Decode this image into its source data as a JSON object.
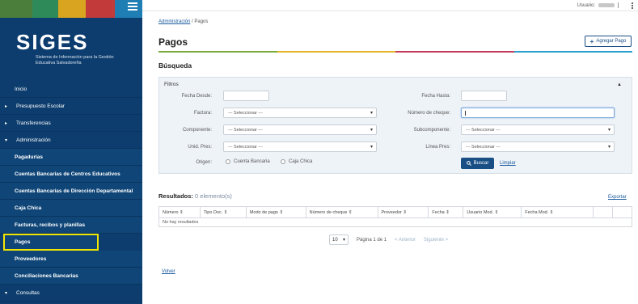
{
  "colors": {
    "sidebar": "#0d3d6e",
    "accent": "#1a4f86",
    "highlight": "#f2e600",
    "stripes": [
      "#4a7e3a",
      "#2f8a5a",
      "#d9a520",
      "#c33a3a",
      "#1f7fb5"
    ]
  },
  "sidebar": {
    "logo_title": "SIGES",
    "logo_subtitle": "Sistema de Información para la Gestión Educativa Salvadoreña",
    "menu_icon": "hamburger-icon",
    "items": [
      {
        "label": "Inicio"
      },
      {
        "label": "Presupuesto Escolar"
      },
      {
        "label": "Transferencias"
      },
      {
        "label": "Administración"
      },
      {
        "label": "Pagadurías"
      },
      {
        "label": "Cuentas Bancarias de Centros Educativos"
      },
      {
        "label": "Cuentas Bancarias de Dirección Departamental"
      },
      {
        "label": "Caja Chica"
      },
      {
        "label": "Facturas, recibos y planillas"
      },
      {
        "label": "Pagos"
      },
      {
        "label": "Proveedores"
      },
      {
        "label": "Conciliaciones Bancarias"
      },
      {
        "label": "Consultas"
      }
    ]
  },
  "topbar": {
    "user_label": "Usuario:",
    "sep": "|"
  },
  "breadcrumb": {
    "parent": "Administración",
    "sep": "/",
    "current": "Pagos"
  },
  "page": {
    "title": "Pagos",
    "add_button": "Agregar Pago",
    "add_icon": "+"
  },
  "search": {
    "title": "Búsqueda",
    "filters_title": "Filtros",
    "collapse_icon": "▲",
    "fecha_desde": "Fecha Desde:",
    "fecha_hasta": "Fecha Hasta:",
    "factura": "Factura:",
    "numero_cheque": "Número de cheque:",
    "componente": "Componente:",
    "subcomponente": "Subcomponente:",
    "unid_pres": "Unid. Pres:",
    "linea_pres": "Línea Pres:",
    "origen": "Origen:",
    "select_placeholder": "--- Seleccionar ---",
    "radio_1": "Cuenta Bancaria",
    "radio_2": "Caja Chica",
    "buscar": "Buscar",
    "buscar_icon": "search-icon",
    "limpiar": "Limpiar"
  },
  "results": {
    "label": "Resultados:",
    "count": "0 elemento(s)",
    "export": "Exportar",
    "columns": [
      "Número",
      "Tipo Doc.",
      "Modo de pago",
      "Número de cheque",
      "Proveedor",
      "Fecha",
      "Usuario Mod.",
      "Fecha Mod.",
      "",
      ""
    ],
    "empty": "No hay resultados"
  },
  "pager": {
    "size": "10",
    "page_info": "Página 1 de 1",
    "prev": "< Anterior",
    "next": "Siguiente >"
  },
  "volver": "Volver"
}
